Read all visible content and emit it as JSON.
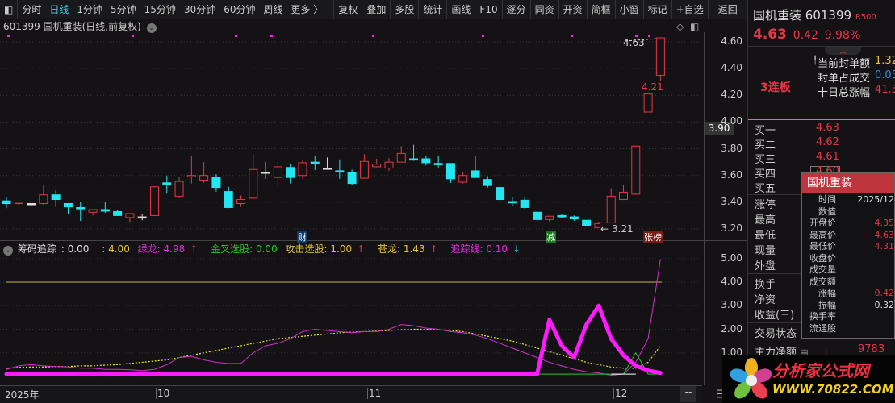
{
  "toolbar": {
    "items": [
      "分时",
      "日线",
      "1分钟",
      "5分钟",
      "15分钟",
      "30分钟",
      "60分钟",
      "周线",
      "更多 〉"
    ],
    "actions": [
      "复权",
      "叠加",
      "多股",
      "统计",
      "画线",
      "F10",
      "逐分",
      "同资",
      "开资",
      "简框",
      "小窗",
      "标记",
      "+自选",
      "返回"
    ]
  },
  "title": "601399 国机重装(日线,前复权)",
  "price_axis": [
    "4.60",
    "4.40",
    "4.20",
    "4.00",
    "3.80",
    "3.60",
    "3.40",
    "3.20"
  ],
  "current_price_tag": "3.90",
  "annotations": {
    "high": "4.63",
    "low": "3.21",
    "limit": "4.21",
    "badge_cai": "财",
    "badge_jian": "减",
    "badge_zhangbang": "张榜"
  },
  "indicator": {
    "name": "筹码追踪",
    "v1": ": 0.00",
    "v2": ": 4.00",
    "lvlong": "绿龙: 4.98",
    "jincha": "金叉选股: 0.00",
    "gongji": "攻击选股: 1.00",
    "canglong": "苍龙: 1.43",
    "zhuizong": "追踪线: 0.10",
    "axis": [
      "5.00",
      "4.00",
      "3.00",
      "2.00",
      "1.00"
    ]
  },
  "xaxis": {
    "labels": [
      "2025年",
      "10",
      "11",
      "12"
    ],
    "dash": "--",
    "period": "日"
  },
  "panel": {
    "name": "国机重装",
    "code": "601399",
    "tag": "R500",
    "price": "4.63",
    "change": "0.42",
    "pct": "9.98%",
    "boards": "3连板",
    "stats": [
      {
        "k": "当前封单额",
        "v": "1.32"
      },
      {
        "k": "封单占成交",
        "v": "0.05"
      },
      {
        "k": "十日总涨幅",
        "v": "41.5"
      }
    ],
    "book": [
      {
        "k": "买一",
        "v": "4.63"
      },
      {
        "k": "买二",
        "v": "4.62"
      },
      {
        "k": "买三",
        "v": "4.61"
      },
      {
        "k": "买四",
        "v": "4.60"
      },
      {
        "k": "买五",
        "v": ""
      }
    ],
    "quote": [
      "涨停",
      "最高",
      "最低",
      "现量",
      "外盘"
    ],
    "quote2": [
      "换手",
      "净资",
      "收益(三)"
    ],
    "status": "交易状态",
    "main_net": "主力净额",
    "main_net_val": "9783"
  },
  "tooltip": {
    "title": "国机重装",
    "rows": [
      {
        "k": "时间",
        "v": "2025/12"
      },
      {
        "k": "数值",
        "v": ""
      },
      {
        "k": "开盘价",
        "v": "4.35"
      },
      {
        "k": "最高价",
        "v": "4.63"
      },
      {
        "k": "最低价",
        "v": "4.31"
      },
      {
        "k": "收盘价",
        "v": ""
      },
      {
        "k": "成交量",
        "v": ""
      },
      {
        "k": "成交额",
        "v": ""
      },
      {
        "k": "涨幅",
        "v": "0.42"
      },
      {
        "k": "振幅",
        "v": "0.32"
      },
      {
        "k": "换手率",
        "v": ""
      },
      {
        "k": "流通股",
        "v": ""
      }
    ]
  },
  "watermark": {
    "name": "分析家公式网",
    "url": "WWW.70822.COM"
  },
  "colors": {
    "up": "#e6374a",
    "down": "#22e6f0",
    "flat": "#dddddd",
    "magenta": "#ff1aff",
    "yellow": "#e6e63a",
    "green": "#22cc22"
  },
  "chart_data": {
    "type": "candlestick",
    "ylim": [
      3.15,
      4.68
    ],
    "ohlc": [
      [
        3.41,
        3.435,
        3.355,
        3.39
      ],
      [
        3.39,
        3.405,
        3.365,
        3.4
      ],
      [
        3.39,
        3.39,
        3.365,
        3.39
      ],
      [
        3.39,
        3.53,
        3.38,
        3.455
      ],
      [
        3.455,
        3.49,
        3.365,
        3.42
      ],
      [
        3.39,
        3.39,
        3.315,
        3.365
      ],
      [
        3.36,
        3.405,
        3.26,
        3.35
      ],
      [
        3.325,
        3.345,
        3.3,
        3.345
      ],
      [
        3.345,
        3.405,
        3.32,
        3.333
      ],
      [
        3.33,
        3.345,
        3.3,
        3.3
      ],
      [
        3.285,
        3.315,
        3.245,
        3.315
      ],
      [
        3.29,
        3.315,
        3.265,
        3.29
      ],
      [
        3.3,
        3.52,
        3.3,
        3.515
      ],
      [
        3.545,
        3.6,
        3.465,
        3.535
      ],
      [
        3.445,
        3.59,
        3.43,
        3.555
      ],
      [
        3.59,
        3.745,
        3.54,
        3.6
      ],
      [
        3.565,
        3.7,
        3.545,
        3.6
      ],
      [
        3.585,
        3.61,
        3.48,
        3.51
      ],
      [
        3.48,
        3.515,
        3.355,
        3.36
      ],
      [
        3.39,
        3.45,
        3.365,
        3.42
      ],
      [
        3.43,
        3.76,
        3.425,
        3.645
      ],
      [
        3.625,
        3.7,
        3.575,
        3.625
      ],
      [
        3.585,
        3.7,
        3.515,
        3.665
      ],
      [
        3.66,
        3.69,
        3.54,
        3.585
      ],
      [
        3.6,
        3.72,
        3.575,
        3.695
      ],
      [
        3.7,
        3.745,
        3.64,
        3.69
      ],
      [
        3.655,
        3.735,
        3.65,
        3.655
      ],
      [
        3.635,
        3.72,
        3.575,
        3.625
      ],
      [
        3.625,
        3.645,
        3.53,
        3.54
      ],
      [
        3.58,
        3.76,
        3.575,
        3.705
      ],
      [
        3.665,
        3.725,
        3.66,
        3.685
      ],
      [
        3.655,
        3.73,
        3.635,
        3.7
      ],
      [
        3.7,
        3.82,
        3.7,
        3.765
      ],
      [
        3.725,
        3.83,
        3.71,
        3.715
      ],
      [
        3.725,
        3.75,
        3.675,
        3.695
      ],
      [
        3.69,
        3.75,
        3.66,
        3.68
      ],
      [
        3.69,
        3.69,
        3.545,
        3.575
      ],
      [
        3.55,
        3.625,
        3.54,
        3.6
      ],
      [
        3.635,
        3.745,
        3.585,
        3.585
      ],
      [
        3.57,
        3.595,
        3.51,
        3.525
      ],
      [
        3.51,
        3.53,
        3.4,
        3.42
      ],
      [
        3.405,
        3.44,
        3.37,
        3.395
      ],
      [
        3.415,
        3.44,
        3.35,
        3.36
      ],
      [
        3.325,
        3.34,
        3.26,
        3.27
      ],
      [
        3.27,
        3.295,
        3.255,
        3.295
      ],
      [
        3.3,
        3.31,
        3.28,
        3.29
      ],
      [
        3.29,
        3.3,
        3.26,
        3.275
      ],
      [
        3.265,
        3.265,
        3.22,
        3.225
      ],
      [
        3.21,
        3.25,
        3.21,
        3.24
      ],
      [
        3.24,
        3.505,
        3.24,
        3.445
      ],
      [
        3.42,
        3.525,
        3.42,
        3.475
      ],
      [
        3.46,
        3.82,
        3.455,
        3.82
      ],
      [
        4.075,
        4.21,
        4.075,
        4.21
      ],
      [
        4.35,
        4.63,
        4.31,
        4.63
      ]
    ],
    "indicator_ylim": [
      0,
      5.2
    ],
    "lvlong": [
      0.3,
      0.45,
      0.5,
      0.45,
      0.42,
      0.4,
      0.35,
      0.35,
      0.3,
      0.3,
      0.28,
      0.25,
      0.3,
      0.5,
      0.8,
      0.85,
      0.7,
      0.6,
      0.55,
      0.55,
      1.0,
      1.3,
      1.4,
      1.6,
      1.9,
      2.0,
      1.95,
      1.9,
      1.85,
      1.9,
      1.9,
      2.0,
      2.2,
      2.15,
      2.05,
      2.0,
      1.9,
      1.85,
      1.75,
      1.6,
      1.4,
      1.2,
      1.0,
      0.8,
      0.6,
      0.45,
      0.3,
      0.2,
      0.15,
      0.05,
      0.1,
      0.6,
      1.6,
      4.98
    ],
    "canglong": [
      0.35,
      0.38,
      0.4,
      0.4,
      0.42,
      0.42,
      0.45,
      0.45,
      0.48,
      0.5,
      0.55,
      0.6,
      0.65,
      0.7,
      0.8,
      0.9,
      1.0,
      1.1,
      1.2,
      1.3,
      1.4,
      1.5,
      1.6,
      1.65,
      1.7,
      1.75,
      1.8,
      1.85,
      1.88,
      1.9,
      1.92,
      1.95,
      1.98,
      2.0,
      2.0,
      1.98,
      1.95,
      1.9,
      1.8,
      1.7,
      1.6,
      1.5,
      1.35,
      1.2,
      1.05,
      0.9,
      0.75,
      0.6,
      0.5,
      0.4,
      0.35,
      0.35,
      0.6,
      1.3
    ],
    "zhuizong": [
      0.1,
      0.1,
      0.1,
      0.1,
      0.1,
      0.1,
      0.1,
      0.1,
      0.1,
      0.1,
      0.1,
      0.1,
      0.1,
      0.1,
      0.1,
      0.1,
      0.1,
      0.1,
      0.1,
      0.1,
      0.1,
      0.1,
      0.1,
      0.1,
      0.1,
      0.1,
      0.1,
      0.1,
      0.1,
      0.1,
      0.1,
      0.1,
      0.1,
      0.1,
      0.1,
      0.1,
      0.1,
      0.1,
      0.1,
      0.1,
      0.1,
      0.1,
      0.1,
      0.1,
      2.4,
      1.3,
      0.8,
      2.2,
      3.0,
      1.6,
      0.9,
      0.45,
      0.25,
      0.15
    ],
    "jincha": [
      null,
      null,
      null,
      null,
      null,
      null,
      null,
      null,
      null,
      null,
      null,
      null,
      null,
      null,
      null,
      null,
      null,
      null,
      null,
      null,
      null,
      null,
      null,
      null,
      null,
      null,
      null,
      null,
      null,
      null,
      null,
      null,
      null,
      null,
      null,
      null,
      null,
      null,
      null,
      null,
      null,
      null,
      null,
      0.1,
      0.1,
      0.1,
      0.1,
      0.1,
      0.1,
      0.1,
      0.1,
      1.0,
      0.1,
      0.1
    ],
    "level_line": 4.0
  }
}
